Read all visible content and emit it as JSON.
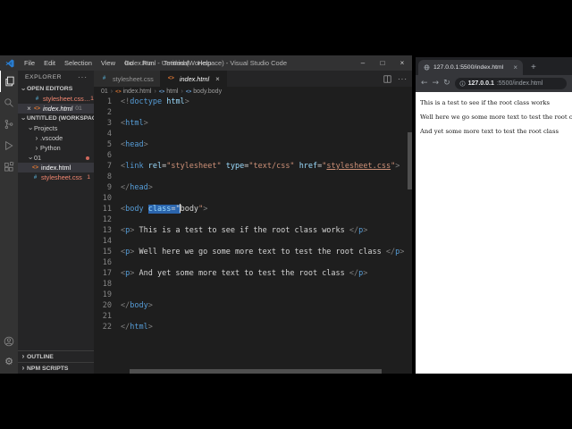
{
  "vscode": {
    "title": "index.html - Untitled (Workspace) - Visual Studio Code",
    "menus": [
      "File",
      "Edit",
      "Selection",
      "View",
      "Go",
      "Run",
      "Terminal",
      "Help"
    ],
    "activity_bar": [
      {
        "name": "explorer",
        "active": true
      },
      {
        "name": "search"
      },
      {
        "name": "source-control"
      },
      {
        "name": "run-debug"
      },
      {
        "name": "extensions"
      }
    ],
    "activity_bar_bottom": [
      {
        "name": "account"
      },
      {
        "name": "settings"
      }
    ],
    "explorer": {
      "header": "EXPLORER",
      "open_editors_label": "OPEN EDITORS",
      "open_editors": [
        {
          "label": "stylesheet.css…",
          "icon": "css",
          "error": true,
          "badge": "1"
        },
        {
          "label": "index.html",
          "icon": "html",
          "detail": "01",
          "selected": true,
          "close": true,
          "italic": true
        }
      ],
      "workspace_label": "UNTITLED (WORKSPACE)",
      "tree": [
        {
          "label": "Projects",
          "chevron": "down",
          "depth": 0
        },
        {
          "label": ".vscode",
          "chevron": "right",
          "depth": 1
        },
        {
          "label": "Python",
          "chevron": "right",
          "depth": 1
        },
        {
          "label": "01",
          "chevron": "down",
          "depth": 0,
          "dot": true
        },
        {
          "label": "index.html",
          "icon": "html",
          "depth": 1,
          "selected": true
        },
        {
          "label": "stylesheet.css",
          "icon": "css",
          "depth": 1,
          "error": true,
          "badge": "1"
        }
      ],
      "bottom_sections": [
        "OUTLINE",
        "NPM SCRIPTS"
      ]
    },
    "tabs": [
      {
        "label": "stylesheet.css",
        "icon": "css",
        "active": false
      },
      {
        "label": "index.html",
        "icon": "html",
        "active": true,
        "italic": true,
        "close": true
      }
    ],
    "breadcrumb": [
      {
        "label": "01"
      },
      {
        "label": "index.html",
        "icon": "html"
      },
      {
        "label": "html",
        "icon": "sym"
      },
      {
        "label": "body.body",
        "icon": "sym"
      }
    ],
    "code": {
      "lines": [
        [
          [
            "p",
            "<!"
          ],
          [
            "t",
            "doctype"
          ],
          [
            "x",
            " "
          ],
          [
            "a",
            "html"
          ],
          [
            "p",
            ">"
          ]
        ],
        [],
        [
          [
            "p",
            "<"
          ],
          [
            "t",
            "html"
          ],
          [
            "p",
            ">"
          ]
        ],
        [],
        [
          [
            "p",
            "<"
          ],
          [
            "t",
            "head"
          ],
          [
            "p",
            ">"
          ]
        ],
        [],
        [
          [
            "p",
            "<"
          ],
          [
            "t",
            "link"
          ],
          [
            "x",
            " "
          ],
          [
            "a",
            "rel"
          ],
          [
            "x",
            "="
          ],
          [
            "s",
            "\"stylesheet\""
          ],
          [
            "x",
            " "
          ],
          [
            "a",
            "type"
          ],
          [
            "x",
            "="
          ],
          [
            "s",
            "\"text/css\""
          ],
          [
            "x",
            " "
          ],
          [
            "a",
            "href"
          ],
          [
            "x",
            "="
          ],
          [
            "s",
            "\""
          ],
          [
            "u",
            "stylesheet.css"
          ],
          [
            "s",
            "\""
          ],
          [
            "p",
            ">"
          ]
        ],
        [],
        [
          [
            "p",
            "</"
          ],
          [
            "t",
            "head"
          ],
          [
            "p",
            ">"
          ]
        ],
        [],
        [
          [
            "p",
            "<"
          ],
          [
            "t",
            "body"
          ],
          [
            "x",
            " "
          ],
          [
            "sa",
            "class"
          ],
          [
            "sx",
            "=\""
          ],
          [
            "cur",
            ""
          ],
          [
            "x",
            "body"
          ],
          [
            "s",
            "\""
          ],
          [
            "p",
            ">"
          ]
        ],
        [],
        [
          [
            "p",
            "<"
          ],
          [
            "t",
            "p"
          ],
          [
            "p",
            ">"
          ],
          [
            "x",
            " This is a test to see if the root class works "
          ],
          [
            "p",
            "</"
          ],
          [
            "t",
            "p"
          ],
          [
            "p",
            ">"
          ]
        ],
        [],
        [
          [
            "p",
            "<"
          ],
          [
            "t",
            "p"
          ],
          [
            "p",
            ">"
          ],
          [
            "x",
            " Well here we go some more text to test the root class "
          ],
          [
            "p",
            "</"
          ],
          [
            "t",
            "p"
          ],
          [
            "p",
            ">"
          ]
        ],
        [],
        [
          [
            "p",
            "<"
          ],
          [
            "t",
            "p"
          ],
          [
            "p",
            ">"
          ],
          [
            "x",
            " And yet some more text to test the root class "
          ],
          [
            "p",
            "</"
          ],
          [
            "t",
            "p"
          ],
          [
            "p",
            ">"
          ]
        ],
        [],
        [],
        [
          [
            "p",
            "</"
          ],
          [
            "t",
            "body"
          ],
          [
            "p",
            ">"
          ]
        ],
        [],
        [
          [
            "p",
            "</"
          ],
          [
            "t",
            "html"
          ],
          [
            "p",
            ">"
          ]
        ]
      ]
    }
  },
  "browser": {
    "tab": {
      "title": "127.0.0.1:5500/index.html"
    },
    "toolbar": {
      "url_host": "127.0.0.1",
      "url_rest": ":5500/index.html"
    },
    "content": [
      "This is a test to see if the root class works",
      "Well here we go some more text to test the root class",
      "And yet some more text to test the root class"
    ]
  },
  "colors": {
    "tag_blue": "#569cd6",
    "attr_blue": "#9cdcfe",
    "string_orange": "#ce9178",
    "selection_blue": "#2b65ad",
    "error_red": "#f48771",
    "html_icon_orange": "#e37933",
    "css_icon_blue": "#519aba"
  }
}
